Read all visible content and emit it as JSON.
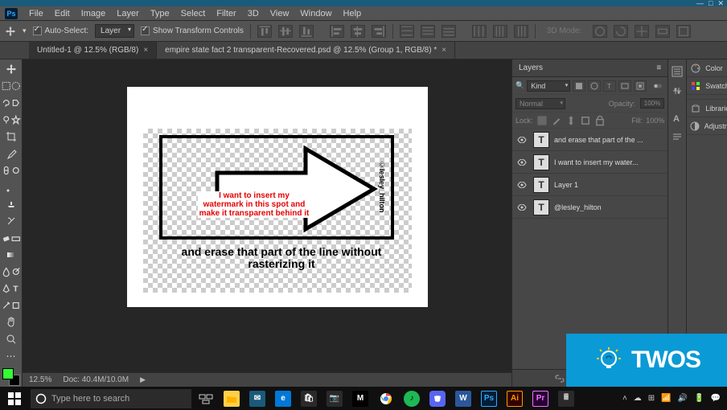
{
  "menubar": [
    "File",
    "Edit",
    "Image",
    "Layer",
    "Type",
    "Select",
    "Filter",
    "3D",
    "View",
    "Window",
    "Help"
  ],
  "options": {
    "auto_select_label": "Auto-Select:",
    "auto_select_value": "Layer",
    "show_transform_label": "Show Transform Controls",
    "mode3d_label": "3D Mode:"
  },
  "tabs": [
    {
      "label": "Untitled-1 @ 12.5% (RGB/8)",
      "active": true
    },
    {
      "label": "empire state fact 2 transparent-Recovered.psd @ 12.5% (Group 1, RGB/8) *",
      "active": false
    }
  ],
  "canvas_text": {
    "red": "I want to insert my watermark in this spot and make it transparent behind it",
    "black": "and erase that part of the line without rasterizing it",
    "vertical": "©lesley_hilton"
  },
  "status": {
    "zoom": "12.5%",
    "doc": "Doc: 40.4M/10.0M"
  },
  "layers_panel": {
    "title": "Layers",
    "kind_label": "Kind",
    "blend_mode": "Normal",
    "opacity_label": "Opacity:",
    "opacity_value": "100%",
    "lock_label": "Lock:",
    "fill_label": "Fill:",
    "fill_value": "100%",
    "items": [
      {
        "name": "and erase that part of the ...",
        "type": "T"
      },
      {
        "name": "I want to insert my water...",
        "type": "T"
      },
      {
        "name": "Layer 1",
        "type": "T"
      },
      {
        "name": "@lesley_hilton",
        "type": "T"
      }
    ]
  },
  "right_panels": [
    "Color",
    "Swatches",
    "Libraries",
    "Adjustments"
  ],
  "taskbar": {
    "search_placeholder": "Type here to search",
    "time": "",
    "date": ""
  },
  "watermark": "TWOS"
}
